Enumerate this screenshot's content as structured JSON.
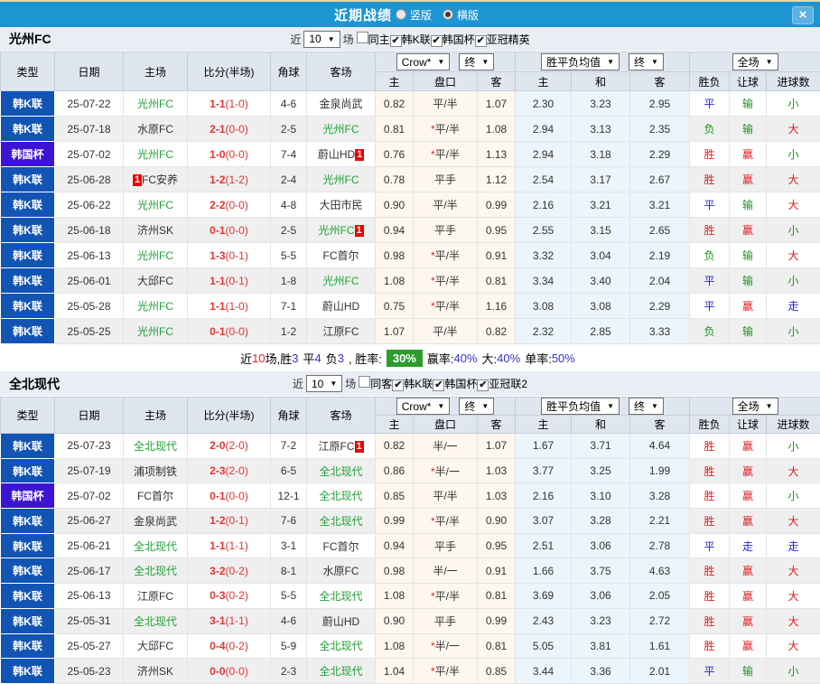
{
  "topbar": {
    "title": "近期战绩",
    "radio_vertical": "竖版",
    "radio_horizontal": "横版",
    "close": "×"
  },
  "filters_common": {
    "near": "近",
    "count": "10",
    "games": "场"
  },
  "header_labels": {
    "type": "类型",
    "date": "日期",
    "home": "主场",
    "score": "比分(半场)",
    "corner": "角球",
    "away": "客场",
    "h": "主",
    "hcap": "盘口",
    "a": "客",
    "w": "主",
    "d": "和",
    "l": "客",
    "wdl": "胜负",
    "handicap_res": "让球",
    "goals": "进球数",
    "bookmaker": "Crow*",
    "final": "终",
    "avg": "胜平负均值",
    "fulltime": "全场"
  },
  "colors": {
    "topbar": "#1d95d3",
    "league": "#1254b4",
    "cup": "#3d14d4",
    "score_red": "#e83333",
    "focal_green": "#22a038",
    "win_red": "#dd2020",
    "draw_blue": "#2323dd",
    "lose_green": "#1d921d",
    "summary_badge_green": "#2e9b2e",
    "cream": "#fdf7ee",
    "avg_blue": "#ebf5fb"
  },
  "sections": [
    {
      "team": "光州FC",
      "checks": [
        {
          "label": "同主",
          "on": false
        },
        {
          "label": "韩K联",
          "on": true
        },
        {
          "label": "韩国杯",
          "on": true
        },
        {
          "label": "亚冠精英",
          "on": true
        }
      ],
      "rows": [
        {
          "type": "韩K联",
          "cup": false,
          "date": "25-07-22",
          "home": "光州FC",
          "hf": true,
          "hb": null,
          "hbp": false,
          "score": "1-1",
          "half": "(1-0)",
          "cor": "4-6",
          "away": "金泉尚武",
          "af": false,
          "ab": null,
          "o1": "0.82",
          "hcap": "平/半",
          "star": false,
          "o2": "1.07",
          "w": "2.30",
          "d": "3.23",
          "l": "2.95",
          "res": [
            [
              "平",
              "blue"
            ],
            [
              "输",
              "green"
            ],
            [
              "小",
              "green"
            ]
          ]
        },
        {
          "type": "韩K联",
          "cup": false,
          "date": "25-07-18",
          "home": "水原FC",
          "hf": false,
          "hb": null,
          "hbp": false,
          "score": "2-1",
          "half": "(0-0)",
          "cor": "2-5",
          "away": "光州FC",
          "af": true,
          "ab": null,
          "o1": "0.81",
          "hcap": "平/半",
          "star": true,
          "o2": "1.08",
          "w": "2.94",
          "d": "3.13",
          "l": "2.35",
          "res": [
            [
              "负",
              "green"
            ],
            [
              "输",
              "green"
            ],
            [
              "大",
              "red"
            ]
          ]
        },
        {
          "type": "韩国杯",
          "cup": true,
          "date": "25-07-02",
          "home": "光州FC",
          "hf": true,
          "hb": null,
          "hbp": false,
          "score": "1-0",
          "half": "(0-0)",
          "cor": "7-4",
          "away": "蔚山HD",
          "af": false,
          "ab": "1",
          "o1": "0.76",
          "hcap": "平/半",
          "star": true,
          "o2": "1.13",
          "w": "2.94",
          "d": "3.18",
          "l": "2.29",
          "res": [
            [
              "胜",
              "red"
            ],
            [
              "赢",
              "red"
            ],
            [
              "小",
              "green"
            ]
          ]
        },
        {
          "type": "韩K联",
          "cup": false,
          "date": "25-06-28",
          "home": "FC安养",
          "hf": false,
          "hb": "1",
          "hbp": true,
          "score": "1-2",
          "half": "(1-2)",
          "cor": "2-4",
          "away": "光州FC",
          "af": true,
          "ab": null,
          "o1": "0.78",
          "hcap": "平手",
          "star": false,
          "o2": "1.12",
          "w": "2.54",
          "d": "3.17",
          "l": "2.67",
          "res": [
            [
              "胜",
              "red"
            ],
            [
              "赢",
              "red"
            ],
            [
              "大",
              "red"
            ]
          ]
        },
        {
          "type": "韩K联",
          "cup": false,
          "date": "25-06-22",
          "home": "光州FC",
          "hf": true,
          "hb": null,
          "hbp": false,
          "score": "2-2",
          "half": "(0-0)",
          "cor": "4-8",
          "away": "大田市民",
          "af": false,
          "ab": null,
          "o1": "0.90",
          "hcap": "平/半",
          "star": false,
          "o2": "0.99",
          "w": "2.16",
          "d": "3.21",
          "l": "3.21",
          "res": [
            [
              "平",
              "blue"
            ],
            [
              "输",
              "green"
            ],
            [
              "大",
              "red"
            ]
          ]
        },
        {
          "type": "韩K联",
          "cup": false,
          "date": "25-06-18",
          "home": "济州SK",
          "hf": false,
          "hb": null,
          "hbp": false,
          "score": "0-1",
          "half": "(0-0)",
          "cor": "2-5",
          "away": "光州FC",
          "af": true,
          "ab": "1",
          "o1": "0.94",
          "hcap": "平手",
          "star": false,
          "o2": "0.95",
          "w": "2.55",
          "d": "3.15",
          "l": "2.65",
          "res": [
            [
              "胜",
              "red"
            ],
            [
              "赢",
              "red"
            ],
            [
              "小",
              "green"
            ]
          ]
        },
        {
          "type": "韩K联",
          "cup": false,
          "date": "25-06-13",
          "home": "光州FC",
          "hf": true,
          "hb": null,
          "hbp": false,
          "score": "1-3",
          "half": "(0-1)",
          "cor": "5-5",
          "away": "FC首尔",
          "af": false,
          "ab": null,
          "o1": "0.98",
          "hcap": "平/半",
          "star": true,
          "o2": "0.91",
          "w": "3.32",
          "d": "3.04",
          "l": "2.19",
          "res": [
            [
              "负",
              "green"
            ],
            [
              "输",
              "green"
            ],
            [
              "大",
              "red"
            ]
          ]
        },
        {
          "type": "韩K联",
          "cup": false,
          "date": "25-06-01",
          "home": "大邱FC",
          "hf": false,
          "hb": null,
          "hbp": false,
          "score": "1-1",
          "half": "(0-1)",
          "cor": "1-8",
          "away": "光州FC",
          "af": true,
          "ab": null,
          "o1": "1.08",
          "hcap": "平/半",
          "star": true,
          "o2": "0.81",
          "w": "3.34",
          "d": "3.40",
          "l": "2.04",
          "res": [
            [
              "平",
              "blue"
            ],
            [
              "输",
              "green"
            ],
            [
              "小",
              "green"
            ]
          ]
        },
        {
          "type": "韩K联",
          "cup": false,
          "date": "25-05-28",
          "home": "光州FC",
          "hf": true,
          "hb": null,
          "hbp": false,
          "score": "1-1",
          "half": "(1-0)",
          "cor": "7-1",
          "away": "蔚山HD",
          "af": false,
          "ab": null,
          "o1": "0.75",
          "hcap": "平/半",
          "star": true,
          "o2": "1.16",
          "w": "3.08",
          "d": "3.08",
          "l": "2.29",
          "res": [
            [
              "平",
              "blue"
            ],
            [
              "赢",
              "red"
            ],
            [
              "走",
              "blue"
            ]
          ]
        },
        {
          "type": "韩K联",
          "cup": false,
          "date": "25-05-25",
          "home": "光州FC",
          "hf": true,
          "hb": null,
          "hbp": false,
          "score": "0-1",
          "half": "(0-0)",
          "cor": "1-2",
          "away": "江原FC",
          "af": false,
          "ab": null,
          "o1": "1.07",
          "hcap": "平/半",
          "star": false,
          "o2": "0.82",
          "w": "2.32",
          "d": "2.85",
          "l": "3.33",
          "res": [
            [
              "负",
              "green"
            ],
            [
              "输",
              "green"
            ],
            [
              "小",
              "green"
            ]
          ]
        }
      ],
      "summary": [
        {
          "t": "近",
          "c": "black"
        },
        {
          "t": "10",
          "c": "red"
        },
        {
          "t": "场,胜",
          "c": "black"
        },
        {
          "t": "3",
          "c": "blue"
        },
        {
          "t": "平",
          "c": "black"
        },
        {
          "t": "4",
          "c": "blue"
        },
        {
          "t": "负",
          "c": "black"
        },
        {
          "t": "3",
          "c": "blue"
        },
        {
          "t": ", 胜率:",
          "c": "black"
        },
        {
          "t": "30%",
          "c": "badge"
        },
        {
          "t": "赢率:",
          "c": "black"
        },
        {
          "t": "40%",
          "c": "blue"
        },
        {
          "t": "大:",
          "c": "black"
        },
        {
          "t": "40%",
          "c": "blue"
        },
        {
          "t": "单率:",
          "c": "black"
        },
        {
          "t": "50%",
          "c": "blue"
        }
      ]
    },
    {
      "team": "全北现代",
      "checks": [
        {
          "label": "同客",
          "on": false
        },
        {
          "label": "韩K联",
          "on": true
        },
        {
          "label": "韩国杯",
          "on": true
        },
        {
          "label": "亚冠联2",
          "on": true
        }
      ],
      "rows": [
        {
          "type": "韩K联",
          "cup": false,
          "date": "25-07-23",
          "home": "全北现代",
          "hf": true,
          "hb": null,
          "hbp": false,
          "score": "2-0",
          "half": "(2-0)",
          "cor": "7-2",
          "away": "江原FC",
          "af": false,
          "ab": "1",
          "o1": "0.82",
          "hcap": "半/一",
          "star": false,
          "o2": "1.07",
          "w": "1.67",
          "d": "3.71",
          "l": "4.64",
          "res": [
            [
              "胜",
              "red"
            ],
            [
              "赢",
              "red"
            ],
            [
              "小",
              "green"
            ]
          ]
        },
        {
          "type": "韩K联",
          "cup": false,
          "date": "25-07-19",
          "home": "浦项制铁",
          "hf": false,
          "hb": null,
          "hbp": false,
          "score": "2-3",
          "half": "(2-0)",
          "cor": "6-5",
          "away": "全北现代",
          "af": true,
          "ab": null,
          "o1": "0.86",
          "hcap": "半/一",
          "star": true,
          "o2": "1.03",
          "w": "3.77",
          "d": "3.25",
          "l": "1.99",
          "res": [
            [
              "胜",
              "red"
            ],
            [
              "赢",
              "red"
            ],
            [
              "大",
              "red"
            ]
          ]
        },
        {
          "type": "韩国杯",
          "cup": true,
          "date": "25-07-02",
          "home": "FC首尔",
          "hf": false,
          "hb": null,
          "hbp": false,
          "score": "0-1",
          "half": "(0-0)",
          "cor": "12-1",
          "away": "全北现代",
          "af": true,
          "ab": null,
          "o1": "0.85",
          "hcap": "平/半",
          "star": false,
          "o2": "1.03",
          "w": "2.16",
          "d": "3.10",
          "l": "3.28",
          "res": [
            [
              "胜",
              "red"
            ],
            [
              "赢",
              "red"
            ],
            [
              "小",
              "green"
            ]
          ]
        },
        {
          "type": "韩K联",
          "cup": false,
          "date": "25-06-27",
          "home": "金泉尚武",
          "hf": false,
          "hb": null,
          "hbp": false,
          "score": "1-2",
          "half": "(0-1)",
          "cor": "7-6",
          "away": "全北现代",
          "af": true,
          "ab": null,
          "o1": "0.99",
          "hcap": "平/半",
          "star": true,
          "o2": "0.90",
          "w": "3.07",
          "d": "3.28",
          "l": "2.21",
          "res": [
            [
              "胜",
              "red"
            ],
            [
              "赢",
              "red"
            ],
            [
              "大",
              "red"
            ]
          ]
        },
        {
          "type": "韩K联",
          "cup": false,
          "date": "25-06-21",
          "home": "全北现代",
          "hf": true,
          "hb": null,
          "hbp": false,
          "score": "1-1",
          "half": "(1-1)",
          "cor": "3-1",
          "away": "FC首尔",
          "af": false,
          "ab": null,
          "o1": "0.94",
          "hcap": "平手",
          "star": false,
          "o2": "0.95",
          "w": "2.51",
          "d": "3.06",
          "l": "2.78",
          "res": [
            [
              "平",
              "blue"
            ],
            [
              "走",
              "blue"
            ],
            [
              "走",
              "blue"
            ]
          ]
        },
        {
          "type": "韩K联",
          "cup": false,
          "date": "25-06-17",
          "home": "全北现代",
          "hf": true,
          "hb": null,
          "hbp": false,
          "score": "3-2",
          "half": "(0-2)",
          "cor": "8-1",
          "away": "水原FC",
          "af": false,
          "ab": null,
          "o1": "0.98",
          "hcap": "半/一",
          "star": false,
          "o2": "0.91",
          "w": "1.66",
          "d": "3.75",
          "l": "4.63",
          "res": [
            [
              "胜",
              "red"
            ],
            [
              "赢",
              "red"
            ],
            [
              "大",
              "red"
            ]
          ]
        },
        {
          "type": "韩K联",
          "cup": false,
          "date": "25-06-13",
          "home": "江原FC",
          "hf": false,
          "hb": null,
          "hbp": false,
          "score": "0-3",
          "half": "(0-2)",
          "cor": "5-5",
          "away": "全北现代",
          "af": true,
          "ab": null,
          "o1": "1.08",
          "hcap": "平/半",
          "star": true,
          "o2": "0.81",
          "w": "3.69",
          "d": "3.06",
          "l": "2.05",
          "res": [
            [
              "胜",
              "red"
            ],
            [
              "赢",
              "red"
            ],
            [
              "大",
              "red"
            ]
          ]
        },
        {
          "type": "韩K联",
          "cup": false,
          "date": "25-05-31",
          "home": "全北现代",
          "hf": true,
          "hb": null,
          "hbp": false,
          "score": "3-1",
          "half": "(1-1)",
          "cor": "4-6",
          "away": "蔚山HD",
          "af": false,
          "ab": null,
          "o1": "0.90",
          "hcap": "平手",
          "star": false,
          "o2": "0.99",
          "w": "2.43",
          "d": "3.23",
          "l": "2.72",
          "res": [
            [
              "胜",
              "red"
            ],
            [
              "赢",
              "red"
            ],
            [
              "大",
              "red"
            ]
          ]
        },
        {
          "type": "韩K联",
          "cup": false,
          "date": "25-05-27",
          "home": "大邱FC",
          "hf": false,
          "hb": null,
          "hbp": false,
          "score": "0-4",
          "half": "(0-2)",
          "cor": "5-9",
          "away": "全北现代",
          "af": true,
          "ab": null,
          "o1": "1.08",
          "hcap": "半/一",
          "star": true,
          "o2": "0.81",
          "w": "5.05",
          "d": "3.81",
          "l": "1.61",
          "res": [
            [
              "胜",
              "red"
            ],
            [
              "赢",
              "red"
            ],
            [
              "大",
              "red"
            ]
          ]
        },
        {
          "type": "韩K联",
          "cup": false,
          "date": "25-05-23",
          "home": "济州SK",
          "hf": false,
          "hb": null,
          "hbp": false,
          "score": "0-0",
          "half": "(0-0)",
          "cor": "2-3",
          "away": "全北现代",
          "af": true,
          "ab": null,
          "o1": "1.04",
          "hcap": "平/半",
          "star": true,
          "o2": "0.85",
          "w": "3.44",
          "d": "3.36",
          "l": "2.01",
          "res": [
            [
              "平",
              "blue"
            ],
            [
              "输",
              "green"
            ],
            [
              "小",
              "green"
            ]
          ]
        }
      ],
      "summary": null
    }
  ]
}
